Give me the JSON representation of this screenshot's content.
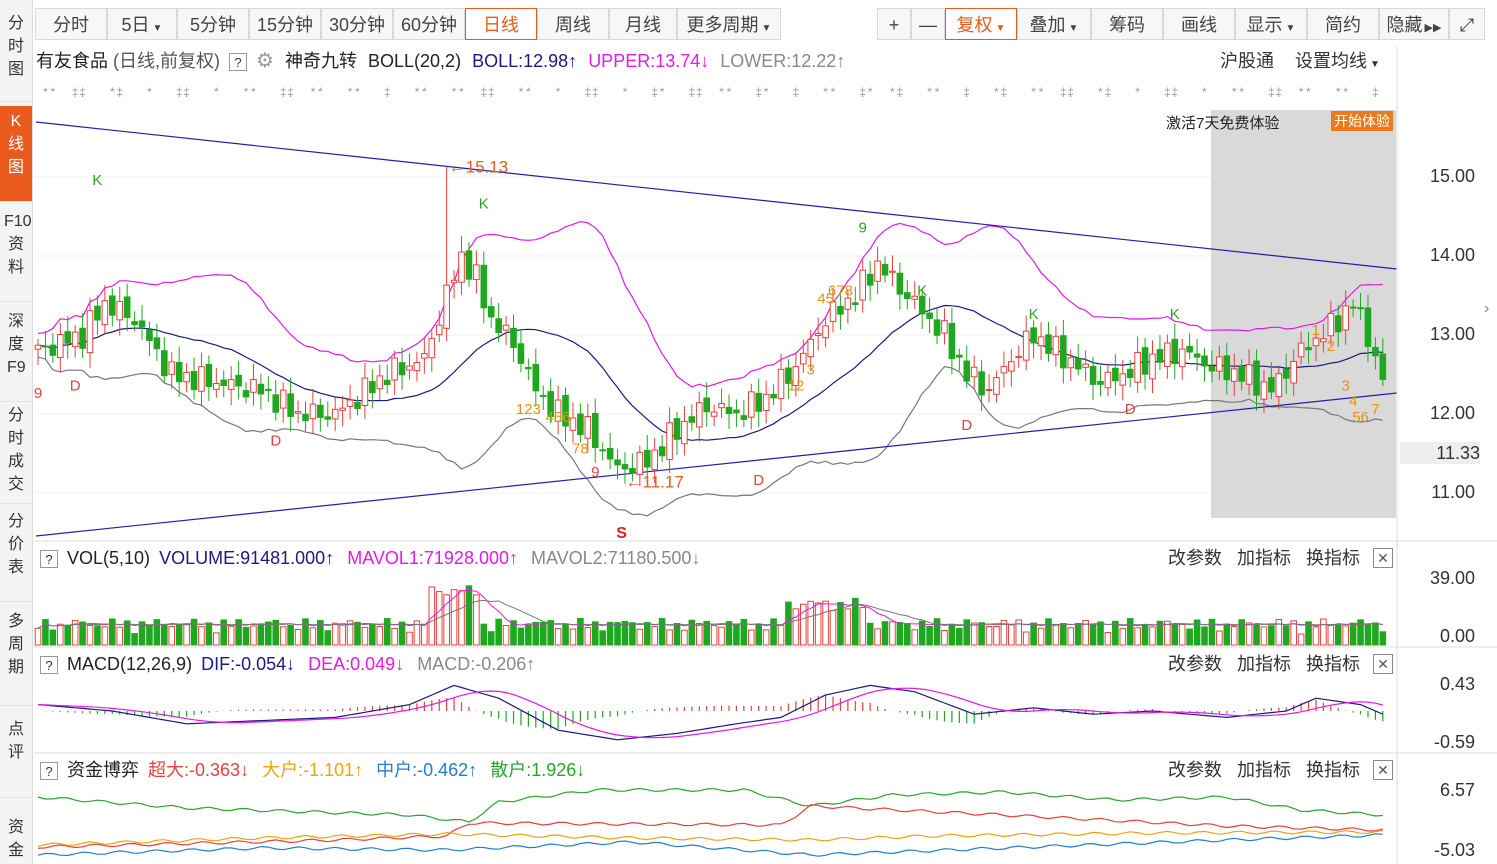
{
  "sidebar": [
    {
      "label": "分时图",
      "active": false
    },
    {
      "label": "K线图",
      "active": true
    },
    {
      "label": "F10资料",
      "active": false
    },
    {
      "label": "深度F9",
      "active": false
    },
    {
      "label": "分时成交",
      "active": false
    },
    {
      "label": "分价表",
      "active": false
    },
    {
      "label": "多周期",
      "active": false
    },
    {
      "label": "点评",
      "active": false
    },
    {
      "label": "资金",
      "active": false
    }
  ],
  "toolbar": {
    "periods": [
      "分时",
      "5日",
      "5分钟",
      "15分钟",
      "30分钟",
      "60分钟",
      "日线",
      "周线",
      "月线",
      "更多周期"
    ],
    "active_period": "日线",
    "tools": [
      "+",
      "—",
      "复权",
      "叠加",
      "筹码",
      "画线",
      "显示",
      "简约",
      "隐藏"
    ],
    "active_tool": "复权",
    "fullscreen_icon": "fullscreen-icon"
  },
  "kline_header": {
    "stock": "有友食品",
    "mode": "(日线,前复权)",
    "q": "?",
    "gear_icon": "gear-icon",
    "indicator": "神奇九转",
    "boll": "BOLL(20,2)",
    "boll_val": "BOLL:12.98",
    "upper_val": "UPPER:13.74",
    "lower_val": "LOWER:12.22",
    "hgt": "沪股通",
    "set_ma": "设置均线"
  },
  "promo": {
    "text": "激活7天免费体验",
    "button": "开始体验"
  },
  "price_axis": [
    "15.00",
    "14.00",
    "13.00",
    "12.00",
    "11.00"
  ],
  "current_price": "11.33",
  "annotations": {
    "high": "15.13",
    "low": "11.17",
    "s_mark": "S"
  },
  "vol_panel": {
    "q": "?",
    "name": "VOL(5,10)",
    "volume": "VOLUME:91481.000",
    "mavol1": "MAVOL1:71928.000",
    "mavol2": "MAVOL2:71180.500",
    "axis": [
      "39.00",
      "0.00"
    ],
    "actions": [
      "改参数",
      "加指标",
      "换指标"
    ]
  },
  "macd_panel": {
    "q": "?",
    "name": "MACD(12,26,9)",
    "dif": "DIF:-0.054",
    "dea": "DEA:0.049",
    "macd": "MACD:-0.206",
    "axis": [
      "0.43",
      "-0.59"
    ],
    "actions": [
      "改参数",
      "加指标",
      "换指标"
    ]
  },
  "fund_panel": {
    "q": "?",
    "name": "资金博弈",
    "super": "超大:-0.363",
    "large": "大户:-1.101",
    "mid": "中户:-0.462",
    "retail": "散户:1.926",
    "axis": [
      "6.57",
      "-5.03"
    ],
    "actions": [
      "改参数",
      "加指标",
      "换指标"
    ]
  },
  "colors": {
    "up": "#e8403c",
    "down": "#1fa81f",
    "upper": "#e619e6",
    "mid": "#1a1a80",
    "lower": "#777777",
    "trend": "#1f1fb0",
    "accent": "#ea5a1c",
    "nine": "#e8940c"
  }
}
